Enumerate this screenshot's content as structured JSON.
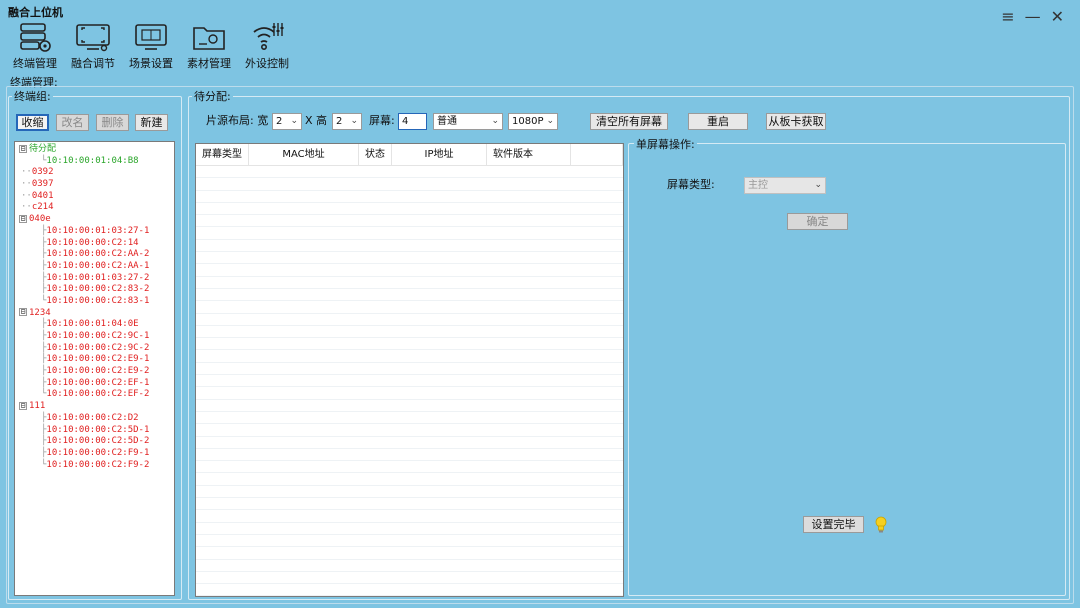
{
  "app": {
    "title": "融合上位机"
  },
  "window_controls": {
    "menu": "≡",
    "minimize": "—",
    "close": "✕"
  },
  "toolbar": [
    {
      "label": "终端管理",
      "icon": "server-settings-icon"
    },
    {
      "label": "融合调节",
      "icon": "monitor-adjust-icon"
    },
    {
      "label": "场景设置",
      "icon": "scene-screen-icon"
    },
    {
      "label": "素材管理",
      "icon": "folder-media-icon"
    },
    {
      "label": "外设控制",
      "icon": "wireless-control-icon"
    }
  ],
  "section_title": "终端管理:",
  "group_panel": {
    "legend": "终端组:",
    "buttons": {
      "collapse": "收缩",
      "rename": "改名",
      "delete": "删除",
      "new": "新建"
    },
    "tree": [
      {
        "label": "待分配",
        "level": 0,
        "color": "green",
        "expander": "⊟",
        "connector": ""
      },
      {
        "label": "10:10:00:01:04:B8",
        "level": 2,
        "color": "green",
        "expander": "",
        "connector": "└"
      },
      {
        "label": "0392",
        "level": 1,
        "color": "red",
        "expander": "",
        "connector": "··"
      },
      {
        "label": "0397",
        "level": 1,
        "color": "red",
        "expander": "",
        "connector": "··"
      },
      {
        "label": "0401",
        "level": 1,
        "color": "red",
        "expander": "",
        "connector": "··"
      },
      {
        "label": "c214",
        "level": 1,
        "color": "red",
        "expander": "",
        "connector": "··"
      },
      {
        "label": "040e",
        "level": 0,
        "color": "red",
        "expander": "⊟",
        "connector": ""
      },
      {
        "label": "10:10:00:01:03:27-1",
        "level": 2,
        "color": "red",
        "expander": "",
        "connector": "├"
      },
      {
        "label": "10:10:00:00:C2:14",
        "level": 2,
        "color": "red",
        "expander": "",
        "connector": "├"
      },
      {
        "label": "10:10:00:00:C2:AA-2",
        "level": 2,
        "color": "red",
        "expander": "",
        "connector": "├"
      },
      {
        "label": "10:10:00:00:C2:AA-1",
        "level": 2,
        "color": "red",
        "expander": "",
        "connector": "├"
      },
      {
        "label": "10:10:00:01:03:27-2",
        "level": 2,
        "color": "red",
        "expander": "",
        "connector": "├"
      },
      {
        "label": "10:10:00:00:C2:83-2",
        "level": 2,
        "color": "red",
        "expander": "",
        "connector": "├"
      },
      {
        "label": "10:10:00:00:C2:83-1",
        "level": 2,
        "color": "red",
        "expander": "",
        "connector": "└"
      },
      {
        "label": "1234",
        "level": 0,
        "color": "red",
        "expander": "⊟",
        "connector": ""
      },
      {
        "label": "10:10:00:01:04:0E",
        "level": 2,
        "color": "red",
        "expander": "",
        "connector": "├"
      },
      {
        "label": "10:10:00:00:C2:9C-1",
        "level": 2,
        "color": "red",
        "expander": "",
        "connector": "├"
      },
      {
        "label": "10:10:00:00:C2:9C-2",
        "level": 2,
        "color": "red",
        "expander": "",
        "connector": "├"
      },
      {
        "label": "10:10:00:00:C2:E9-1",
        "level": 2,
        "color": "red",
        "expander": "",
        "connector": "├"
      },
      {
        "label": "10:10:00:00:C2:E9-2",
        "level": 2,
        "color": "red",
        "expander": "",
        "connector": "├"
      },
      {
        "label": "10:10:00:00:C2:EF-1",
        "level": 2,
        "color": "red",
        "expander": "",
        "connector": "├"
      },
      {
        "label": "10:10:00:00:C2:EF-2",
        "level": 2,
        "color": "red",
        "expander": "",
        "connector": "└"
      },
      {
        "label": "111",
        "level": 0,
        "color": "red",
        "expander": "⊟",
        "connector": ""
      },
      {
        "label": "10:10:00:00:C2:D2",
        "level": 2,
        "color": "red",
        "expander": "",
        "connector": "├"
      },
      {
        "label": "10:10:00:00:C2:5D-1",
        "level": 2,
        "color": "red",
        "expander": "",
        "connector": "├"
      },
      {
        "label": "10:10:00:00:C2:5D-2",
        "level": 2,
        "color": "red",
        "expander": "",
        "connector": "├"
      },
      {
        "label": "10:10:00:00:C2:F9-1",
        "level": 2,
        "color": "red",
        "expander": "",
        "connector": "├"
      },
      {
        "label": "10:10:00:00:C2:F9-2",
        "level": 2,
        "color": "red",
        "expander": "",
        "connector": "└"
      }
    ]
  },
  "pending_panel": {
    "legend": "待分配:",
    "layout_label": "片源布局: 宽",
    "width_value": "2",
    "x_label": "X 高",
    "height_value": "2",
    "screen_label": "屏幕:",
    "screen_value": "4",
    "mode_value": "普通",
    "resolution_value": "1080P",
    "clear_all_button": "清空所有屏幕",
    "restart_button": "重启",
    "read_from_card_button": "从板卡获取",
    "table_columns": [
      "屏幕类型",
      "MAC地址",
      "状态",
      "IP地址",
      "软件版本",
      ""
    ]
  },
  "single_screen": {
    "legend": "单屏幕操作:",
    "screen_type_label": "屏幕类型:",
    "screen_type_value": "主控",
    "confirm_button": "确定",
    "finish_button": "设置完毕"
  },
  "colors": {
    "background": "#7ec4e2",
    "tree_green": "#2aa52a",
    "tree_red": "#e02020",
    "active_border": "#2566b8"
  }
}
